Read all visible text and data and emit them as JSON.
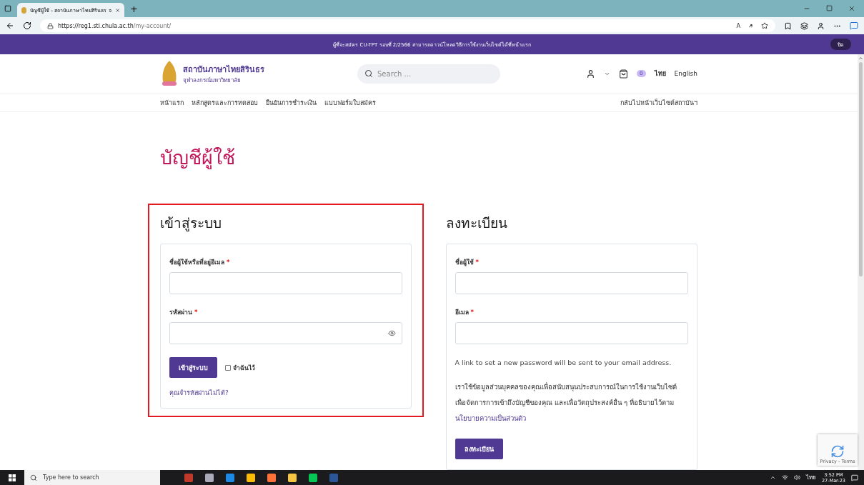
{
  "browser": {
    "tab_title": "บัญชีผู้ใช้ – สถาบันภาษาไทยสิรินธร จ",
    "new_tab": "+",
    "url_host": "https://reg1.sti.chula.ac.th",
    "url_path": "/my-account/",
    "read_aloud": "A",
    "translate": "ꭿ"
  },
  "notice": {
    "text": "ผู้ที่จะสมัคร CU-TPT รอบที่ 2/2566 สามารถดาวน์โหลดวิธีการใช้งานเว็บไซต์ได้ที่หน้าแรก",
    "close": "ปิด"
  },
  "header": {
    "brand_name": "สถาบันภาษาไทยสิรินธร",
    "brand_sub": "จุฬาลงกรณ์มหาวิทยาลัย",
    "search_placeholder": "Search ...",
    "cart_count": "0",
    "languages": [
      {
        "label": "ไทย",
        "selected": true
      },
      {
        "label": "English",
        "selected": false
      }
    ]
  },
  "nav": {
    "items": [
      "หน้าแรก",
      "หลักสูตรและการทดสอบ",
      "ยืนยันการชำระเงิน",
      "แบบฟอร์มใบสมัคร"
    ],
    "back_link": "กลับไปหน้าเว็บไซต์สถาบันฯ"
  },
  "page_title": "บัญชีผู้ใช้",
  "required_mark": "*",
  "login": {
    "title": "เข้าสู่ระบบ",
    "highlighted": true,
    "fields": [
      {
        "label": "ชื่อผู้ใช้หรือที่อยู่อีเมล",
        "required": true,
        "kind": "text"
      },
      {
        "label": "รหัสผ่าน",
        "required": true,
        "kind": "password"
      }
    ],
    "submit": "เข้าสู่ระบบ",
    "remember": {
      "label": "จำฉันไว้",
      "checked": false
    },
    "lost_password": "คุณจำรหัสผ่านไม่ได้?"
  },
  "register": {
    "title": "ลงทะเบียน",
    "fields": [
      {
        "label": "ชื่อผู้ใช้",
        "required": true
      },
      {
        "label": "อีเมล",
        "required": true
      }
    ],
    "note": "A link to set a new password will be sent to your email address.",
    "privacy_text": "เราใช้ข้อมูลส่วนบุคคลของคุณเพื่อสนับสนุนประสบการณ์ในการใช้งานเว็บไซต์ เพื่อจัดการการเข้าถึงบัญชีของคุณ และเพื่อวัตถุประสงค์อื่น ๆ ที่อธิบายไว้ตาม ",
    "privacy_link": "นโยบายความเป็นส่วนตัว",
    "submit": "ลงทะเบียน"
  },
  "recaptcha": {
    "text": "Privacy - Terms"
  },
  "taskbar": {
    "search_placeholder": "Type here to search",
    "language": "ไทย",
    "time": "3:52 PM",
    "date": "27-Mar-23"
  }
}
